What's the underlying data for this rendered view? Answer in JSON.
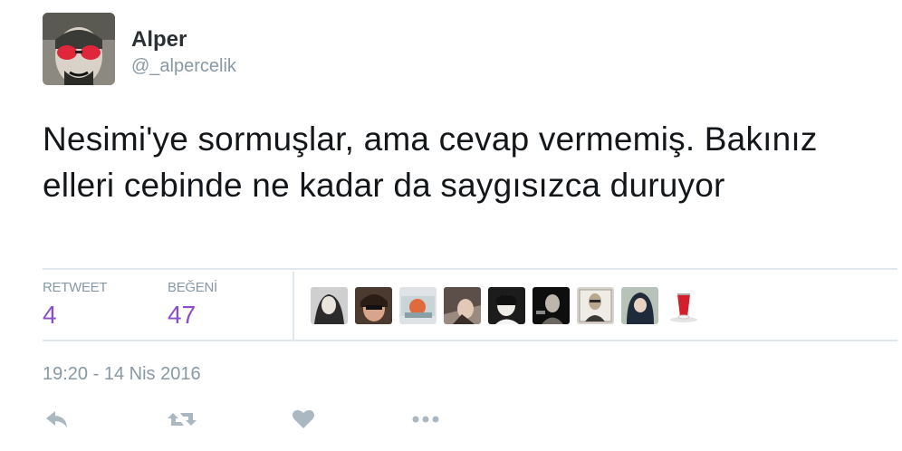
{
  "tweet": {
    "author_name": "Alper",
    "author_handle": "@_alpercelik",
    "text": "Nesimi'ye sormuşlar, ama cevap vermemiş. Bakınız elleri cebinde ne kadar da saygısızca duruyor",
    "timestamp": "19:20 - 14 Nis 2016"
  },
  "stats": {
    "retweet_label": "RETWEET",
    "retweet_count": "4",
    "like_label": "BEĞENİ",
    "like_count": "47"
  },
  "likers_count": 9,
  "actions": [
    "reply-icon",
    "retweet-icon",
    "like-icon",
    "more-icon"
  ],
  "colors": {
    "count_purple": "#8a4fc8",
    "muted_gray": "#8899a6",
    "divider": "#e1e8ed",
    "text": "#14171a"
  }
}
